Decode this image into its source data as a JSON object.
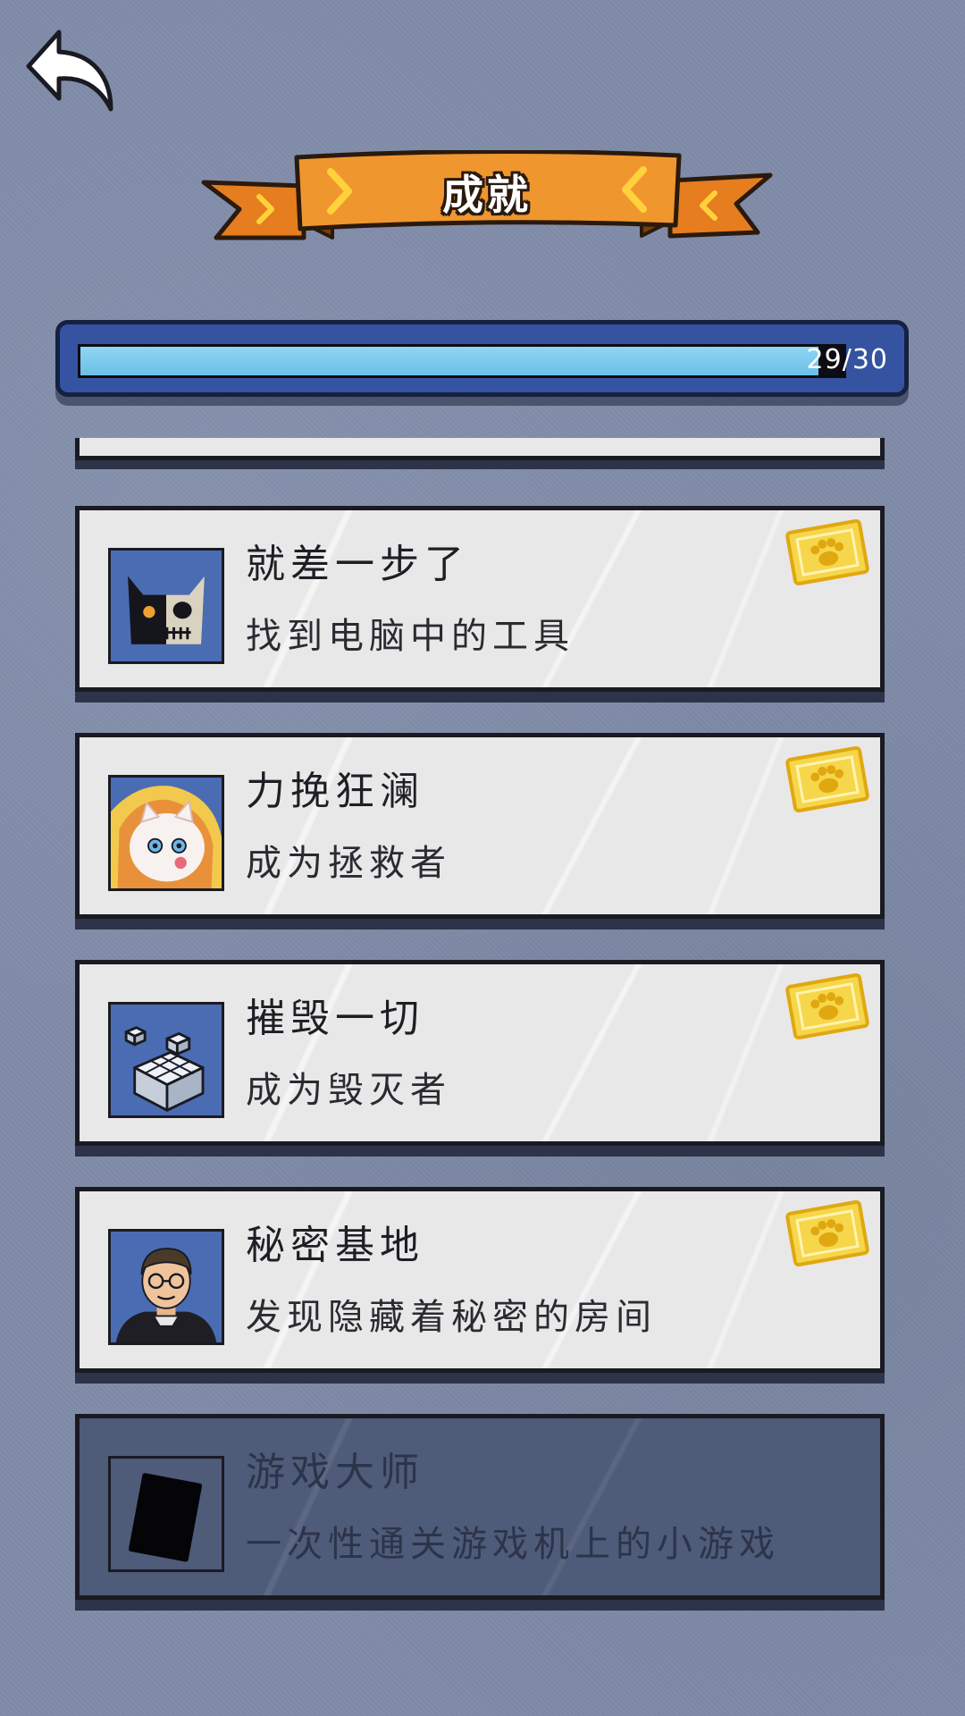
{
  "header": {
    "title": "成就",
    "back_icon": "back-arrow-icon"
  },
  "progress": {
    "current": 29,
    "total": 30,
    "label": "29/30",
    "fill_color": "#8fd6f4",
    "frame_color": "#3553a1"
  },
  "achievements": [
    {
      "title": "就差一步了",
      "description": "找到电脑中的工具",
      "icon": "cat-skull-icon",
      "unlocked": true
    },
    {
      "title": "力挽狂澜",
      "description": "成为拯救者",
      "icon": "kitten-icon",
      "unlocked": true
    },
    {
      "title": "摧毁一切",
      "description": "成为毁灭者",
      "icon": "cubes-icon",
      "unlocked": true
    },
    {
      "title": "秘密基地",
      "description": "发现隐藏着秘密的房间",
      "icon": "man-portrait-icon",
      "unlocked": true
    },
    {
      "title": "游戏大师",
      "description": "一次性通关游戏机上的小游戏",
      "icon": "game-device-icon",
      "unlocked": false
    }
  ],
  "colors": {
    "background": "#7f8ba8",
    "card": "#e8e8e8",
    "card_locked": "#4e5b79",
    "ribbon": "#f0962e",
    "badge": "#f2c21b"
  }
}
